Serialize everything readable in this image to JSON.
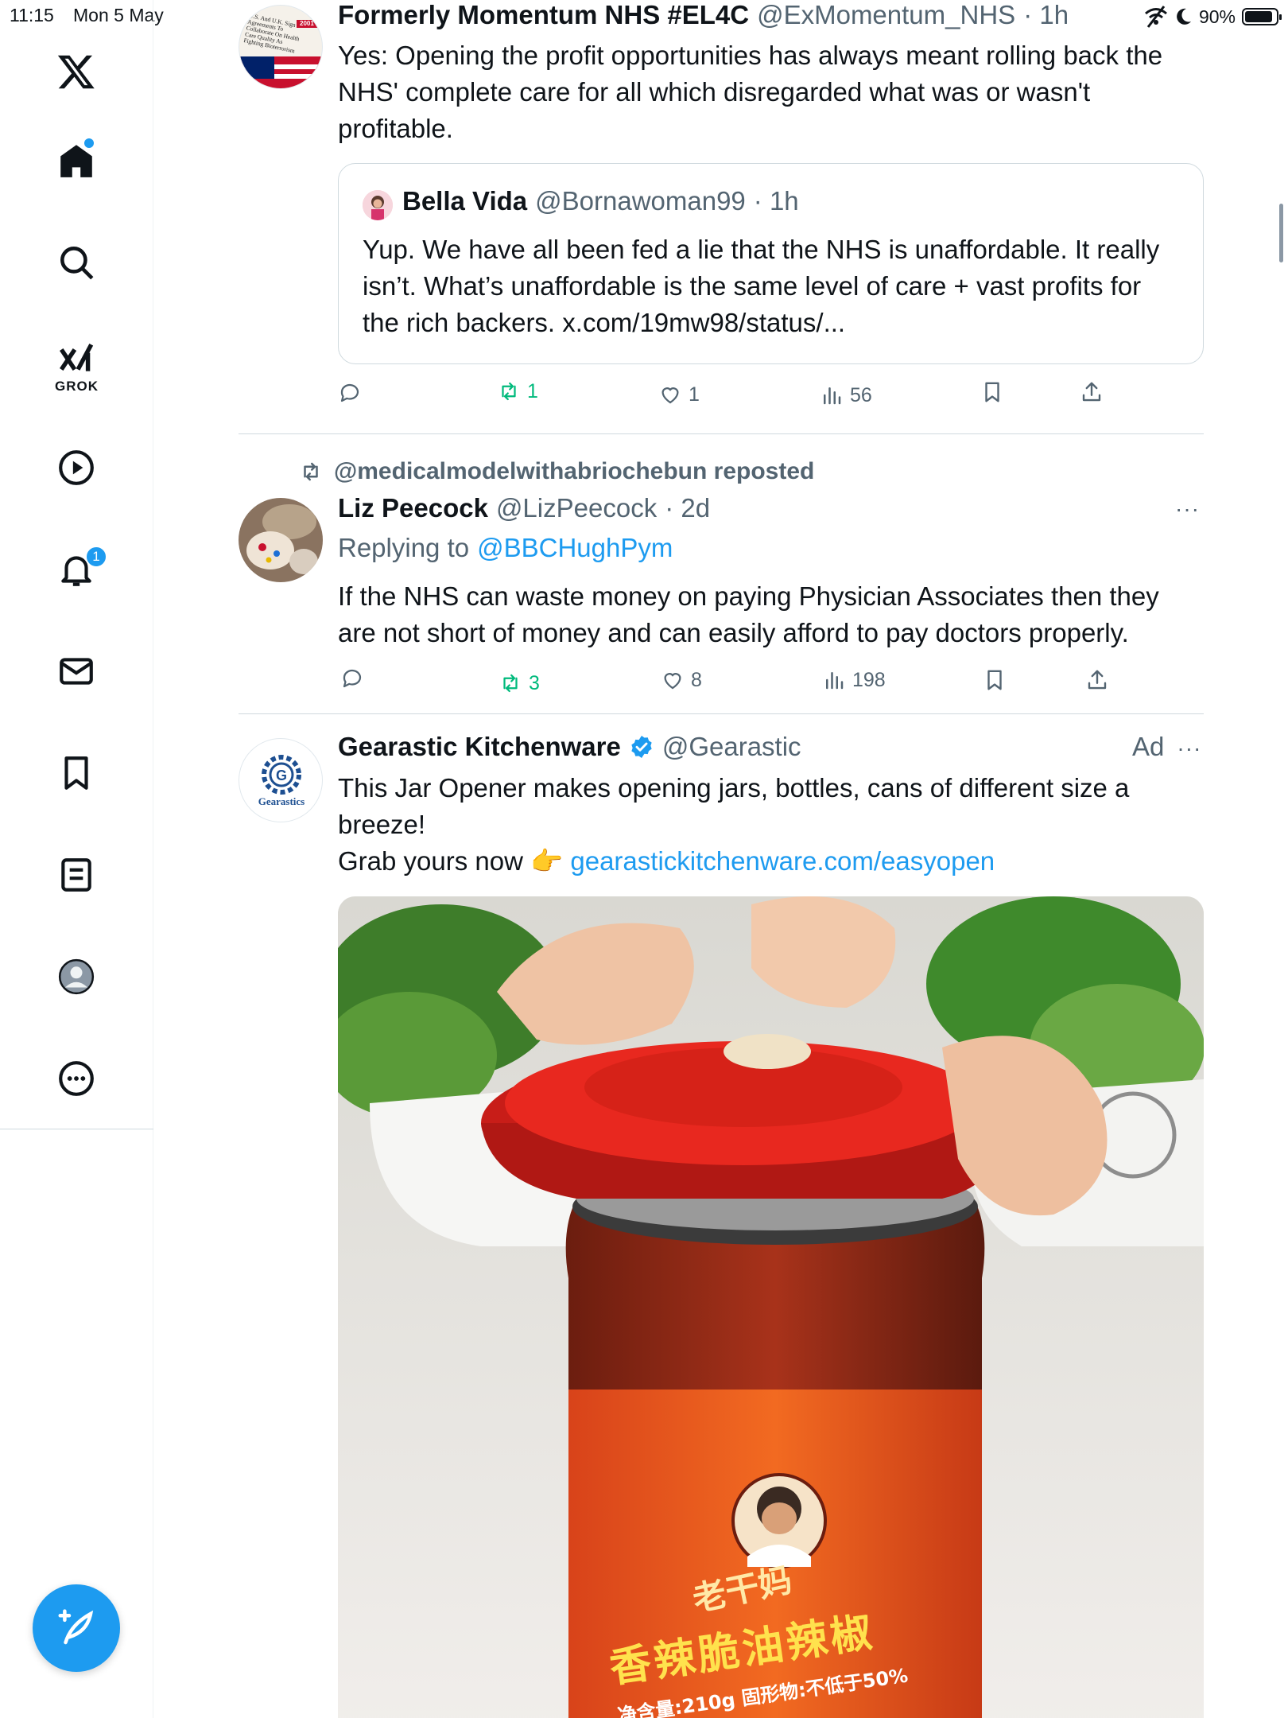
{
  "status_bar": {
    "time": "11:15",
    "date": "Mon 5 May",
    "battery": "90%",
    "battery_level": 0.9
  },
  "sidebar": {
    "grok_label": "GROK",
    "notifications_badge": "1"
  },
  "tweets": [
    {
      "name": "Formerly Momentum NHS #EL4C",
      "handle": "@ExMomentum_NHS",
      "time": "· 1h",
      "body": "Yes: Opening the profit opportunities has always meant rolling back the NHS' complete care for all which disregarded what was or wasn't profitable.",
      "avatar_text": "U.S. And U.K. Sign Agreements To Collaborate On Health Care Quality As Fighting Bioterrorism",
      "avatar_year": "2001",
      "quote": {
        "name": "Bella Vida",
        "handle": "@Bornawoman99",
        "time": "· 1h",
        "body": "Yup. We have all been fed a lie that the NHS is unaffordable. It really isn’t. What’s unaffordable is the same level of care + vast profits for the rich backers. x.com/19mw98/status/..."
      },
      "stats": {
        "reposts": "1",
        "likes": "1",
        "views": "56"
      }
    },
    {
      "repost_label": "@medicalmodelwithabriochebun reposted",
      "name": "Liz Peecock",
      "handle": "@LizPeecock",
      "time": "· 2d",
      "more": "···",
      "replying_prefix": "Replying to",
      "replying_to": "@BBCHughPym",
      "body": "If the NHS can waste money on paying Physician Associates then they are not short of money and can easily afford to pay doctors properly.",
      "stats": {
        "reposts": "3",
        "likes": "8",
        "views": "198"
      }
    },
    {
      "name": "Gearastic Kitchenware",
      "handle": "@Gearastic",
      "ad_label": "Ad",
      "more": "···",
      "avatar_text": "Gearastics",
      "body_line1": "This Jar Opener makes opening jars, bottles, cans of different size a breeze!",
      "body_line2": "Grab yours now 👉",
      "link": "gearastickitchenware.com/easyopen",
      "media": {
        "jar_text": "香辣脆油辣椒",
        "jar_brand": "老干妈",
        "jar_weight": "净含量:210g 固形物:不低于50%"
      }
    }
  ],
  "colors": {
    "accent": "#1d9bf0",
    "repost_green": "#00ba7c",
    "secondary_text": "#536471",
    "border": "#cfd9de"
  }
}
